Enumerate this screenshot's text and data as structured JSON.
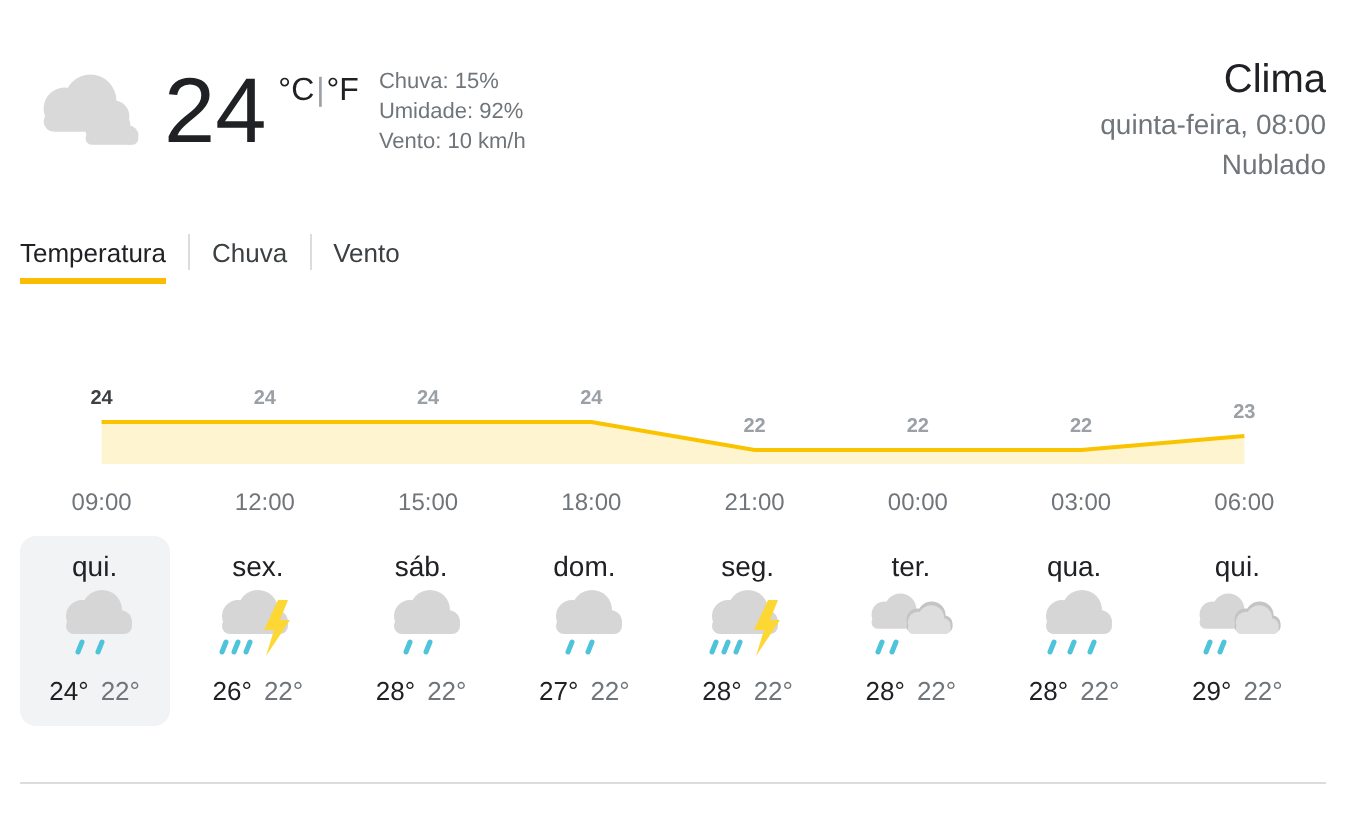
{
  "current": {
    "temperature": "24",
    "unit_c": "°C",
    "separator": "|",
    "unit_f": "°F",
    "details": [
      "Chuva: 15%",
      "Umidade: 92%",
      "Vento: 10 km/h"
    ]
  },
  "location": {
    "title": "Clima",
    "time": "quinta-feira, 08:00",
    "condition": "Nublado"
  },
  "tabs": [
    {
      "label": "Temperatura",
      "selected": true
    },
    {
      "label": "Chuva",
      "selected": false
    },
    {
      "label": "Vento",
      "selected": false
    }
  ],
  "chart_data": {
    "type": "area",
    "categories": [
      "09:00",
      "12:00",
      "15:00",
      "18:00",
      "21:00",
      "00:00",
      "03:00",
      "06:00"
    ],
    "values": [
      24,
      24,
      24,
      24,
      22,
      22,
      22,
      23
    ],
    "data_labels": true
  },
  "days": [
    {
      "day": "qui.",
      "kind": "rain",
      "high": "24°",
      "low": "22°",
      "selected": true
    },
    {
      "day": "sex.",
      "kind": "thunder",
      "high": "26°",
      "low": "22°",
      "selected": false
    },
    {
      "day": "sáb.",
      "kind": "rain",
      "high": "28°",
      "low": "22°",
      "selected": false
    },
    {
      "day": "dom.",
      "kind": "rain",
      "high": "27°",
      "low": "22°",
      "selected": false
    },
    {
      "day": "seg.",
      "kind": "thunder",
      "high": "28°",
      "low": "22°",
      "selected": false
    },
    {
      "day": "ter.",
      "kind": "partly_rain",
      "high": "28°",
      "low": "22°",
      "selected": false
    },
    {
      "day": "qua.",
      "kind": "heavy_rain",
      "high": "28°",
      "low": "22°",
      "selected": false
    },
    {
      "day": "qui.",
      "kind": "partly_rain",
      "high": "29°",
      "low": "22°",
      "selected": false
    }
  ]
}
